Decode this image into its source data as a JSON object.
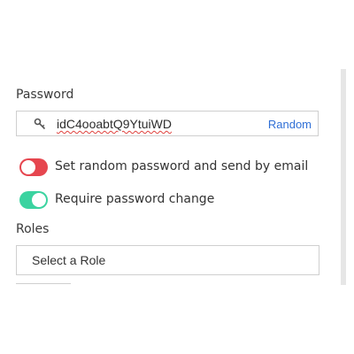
{
  "password_section": {
    "label": "Password",
    "value": "idC4ooabtQ9YtuiWD",
    "random_label": "Random",
    "key_icon": "key-icon"
  },
  "toggles": [
    {
      "label": "Set random password and send by email",
      "enabled": false,
      "color": "#e6464f"
    },
    {
      "label": "Require password change",
      "enabled": true,
      "color": "#3bd3a0"
    }
  ],
  "roles_section": {
    "label": "Roles",
    "placeholder": "Select a Role"
  },
  "colors": {
    "link": "#2f6fd6",
    "border": "#cfcfcf"
  }
}
